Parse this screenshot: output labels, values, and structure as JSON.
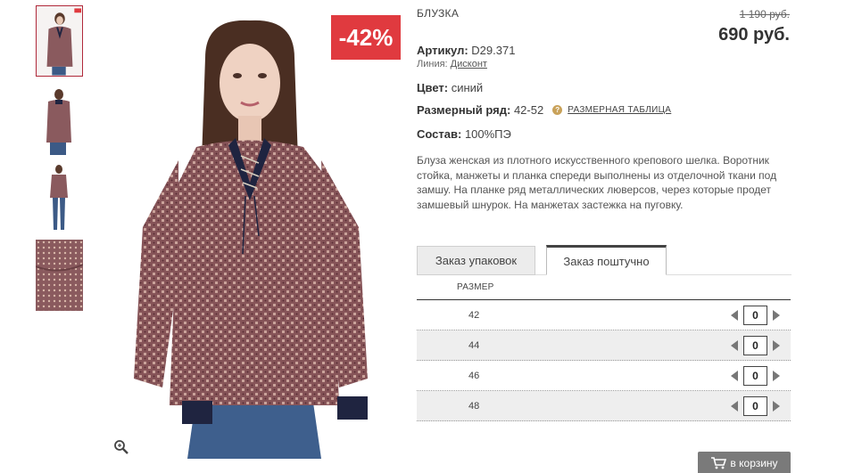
{
  "product": {
    "name": "БЛУЗКА",
    "price_old": "1 190 руб.",
    "price_new": "690 руб.",
    "discount_badge": "-42%",
    "article_label": "Артикул:",
    "article_value": "D29.371",
    "line_label": "Линия:",
    "line_value": "Дисконт",
    "color_label": "Цвет:",
    "color_value": "синий",
    "sizes_label": "Размерный ряд:",
    "sizes_value": "42-52",
    "size_chart_link": "РАЗМЕРНАЯ ТАБЛИЦА",
    "help_icon_glyph": "?",
    "composition_label": "Состав:",
    "composition_value": "100%ПЭ",
    "description": "Блуза женская из плотного искусственного крепового шелка. Воротник стойка, манжеты и планка спереди выполнены из отделочной ткани под замшу. На планке ряд металлических люверсов, через которые продет замшевый шнурок. На манжетах застежка на пуговку."
  },
  "tabs": [
    {
      "label": "Заказ упаковок",
      "active": false
    },
    {
      "label": "Заказ поштучно",
      "active": true
    }
  ],
  "size_table": {
    "header": "РАЗМЕР",
    "rows": [
      {
        "size": "42",
        "qty": "0"
      },
      {
        "size": "44",
        "qty": "0"
      },
      {
        "size": "46",
        "qty": "0"
      },
      {
        "size": "48",
        "qty": "0"
      }
    ]
  },
  "cart_button": {
    "label": "в корзину",
    "icon": "cart-icon"
  },
  "icons": {
    "zoom": "zoom-icon",
    "help": "help-icon",
    "left": "arrow-left-icon",
    "right": "arrow-right-icon"
  },
  "colors": {
    "badge": "#e03a3f",
    "button": "#7a7a7a",
    "blouse": "#8a5a5e",
    "trim": "#1f2440"
  }
}
